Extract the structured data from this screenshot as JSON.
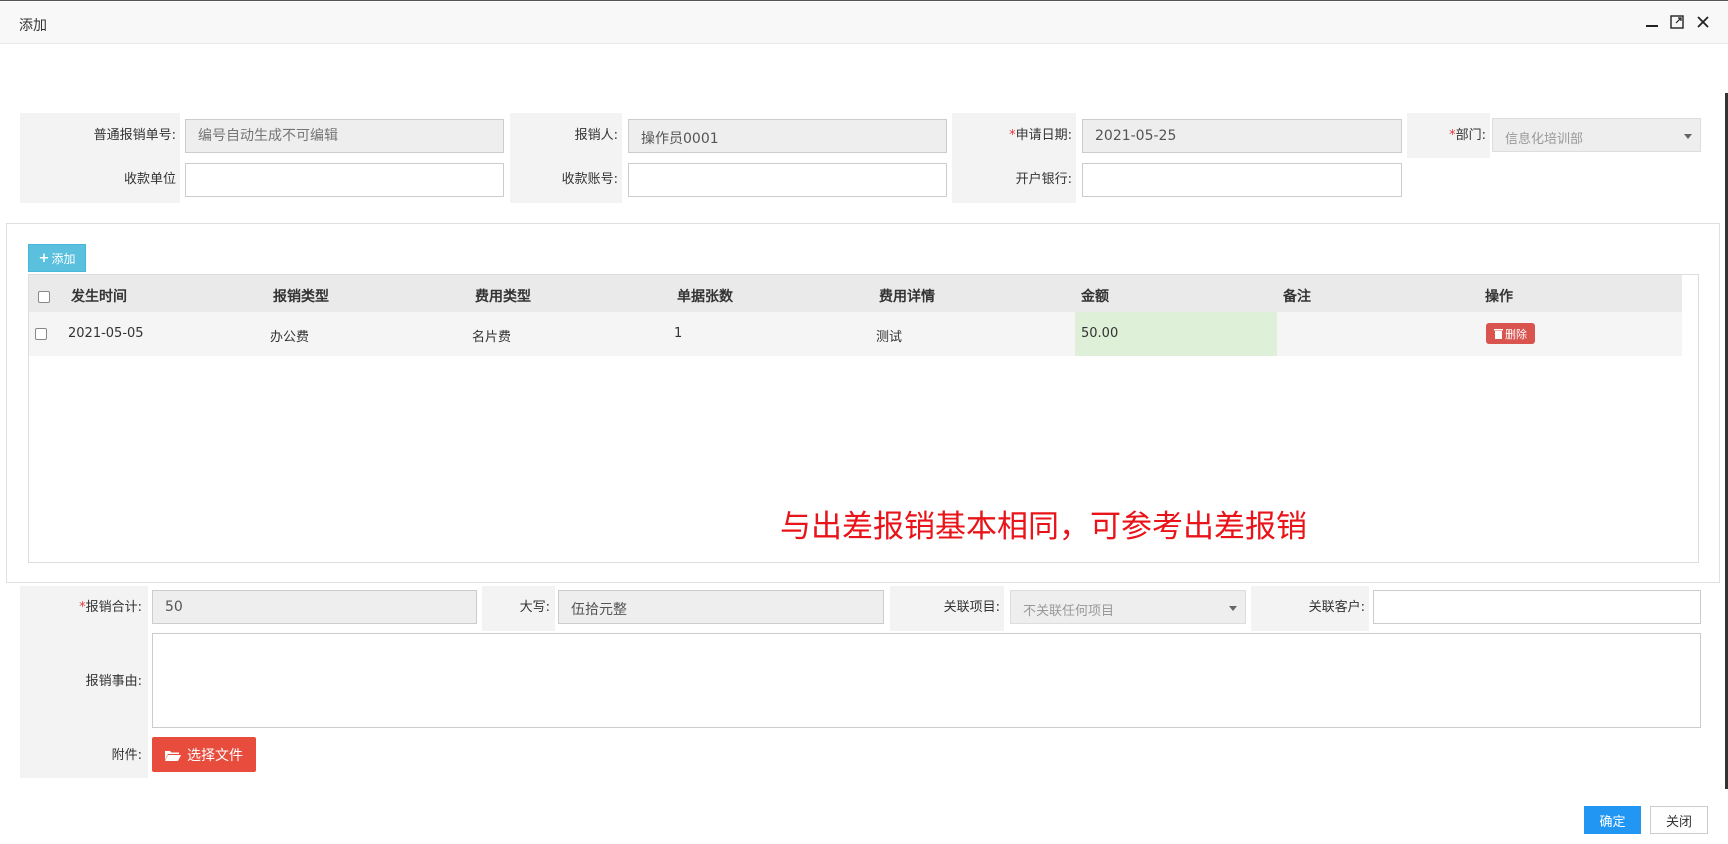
{
  "window": {
    "title": "添加"
  },
  "form": {
    "bill_no_label": "普通报销单号:",
    "bill_no_placeholder": "编号自动生成不可编辑",
    "reporter_label": "报销人:",
    "reporter_value": "操作员0001",
    "date_label": "申请日期:",
    "date_value": "2021-05-25",
    "dept_label": "部门:",
    "dept_value": "信息化培训部",
    "payee_label": "收款单位",
    "account_label": "收款账号:",
    "bank_label": "开户银行:",
    "required_mark": "*"
  },
  "table": {
    "add_label": "添加",
    "columns": [
      "发生时间",
      "报销类型",
      "费用类型",
      "单据张数",
      "费用详情",
      "金额",
      "备注",
      "操作"
    ],
    "rows": [
      {
        "date": "2021-05-05",
        "type": "办公费",
        "fee_type": "名片费",
        "count": "1",
        "detail": "测试",
        "amount": "50.00",
        "remark": "",
        "delete_label": "删除"
      }
    ]
  },
  "note": "与出差报销基本相同，可参考出差报销",
  "footer_form": {
    "total_label": "报销合计:",
    "total_value": "50",
    "upper_label": "大写:",
    "upper_value": "伍拾元整",
    "project_label": "关联项目:",
    "project_value": "不关联任何项目",
    "customer_label": "关联客户:",
    "reason_label": "报销事由:",
    "attach_label": "附件:",
    "file_button": "选择文件"
  },
  "actions": {
    "confirm": "确定",
    "close": "关闭"
  },
  "colors": {
    "primary": "#2196f3",
    "danger": "#d9534f",
    "info": "#5bc0de",
    "file": "#e74c3c",
    "note": "#e8141a"
  }
}
